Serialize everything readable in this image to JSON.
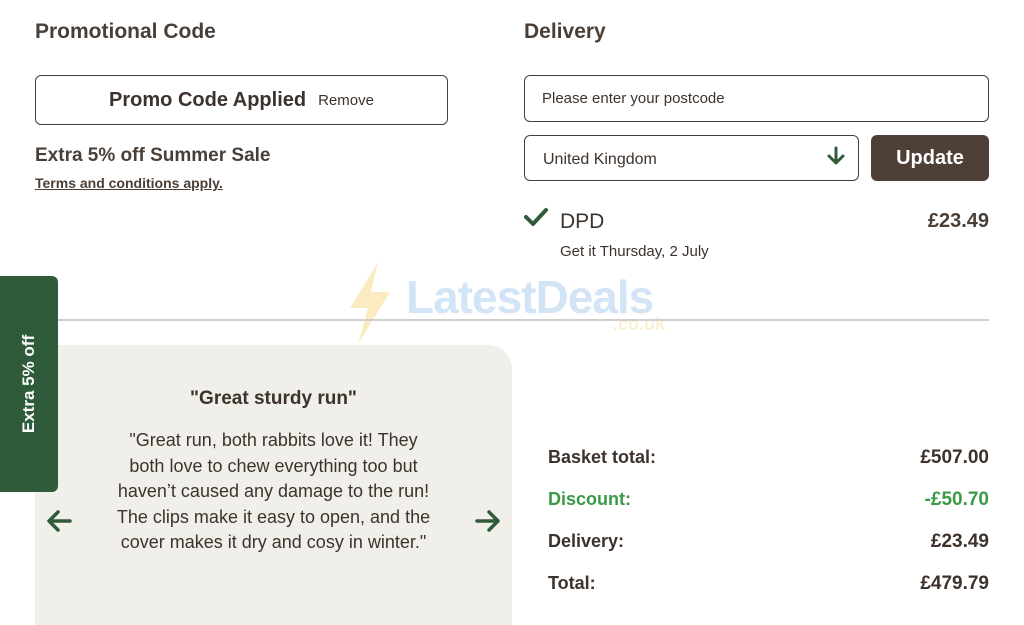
{
  "promo": {
    "heading": "Promotional Code",
    "applied_label": "Promo Code Applied",
    "remove_label": "Remove",
    "sale_text": "Extra 5% off Summer Sale",
    "terms_link": "Terms and conditions apply."
  },
  "delivery": {
    "heading": "Delivery",
    "postcode_placeholder": "Please enter your postcode",
    "country_selected": "United Kingdom",
    "update_label": "Update",
    "option": {
      "carrier": "DPD",
      "eta": "Get it Thursday, 2 July",
      "price": "£23.49"
    }
  },
  "watermark": {
    "brand": "LatestDeals",
    "domain": ".co.uk"
  },
  "side_tab": {
    "label": "Extra 5% off"
  },
  "review": {
    "title": "\"Great sturdy run\"",
    "body": "\"Great run, both rabbits love it! They both love to chew everything too but haven’t caused any damage to the run! The clips make it easy to open, and the cover makes it dry and cosy in winter.\""
  },
  "summary": {
    "basket_label": "Basket total:",
    "basket_value": "£507.00",
    "discount_label": "Discount:",
    "discount_value": "-£50.70",
    "delivery_label": "Delivery:",
    "delivery_value": "£23.49",
    "total_label": "Total:",
    "total_value": "£479.79"
  },
  "colors": {
    "text_brown": "#4a3f37",
    "button_brown": "#4e3f37",
    "tab_green": "#2f5b3b",
    "discount_green": "#3a9a48",
    "review_bg": "#f1efea"
  },
  "icons": {
    "country_dropdown": "arrow-down-icon",
    "selected_delivery": "check-icon",
    "review_prev": "arrow-left-icon",
    "review_next": "arrow-right-icon"
  }
}
